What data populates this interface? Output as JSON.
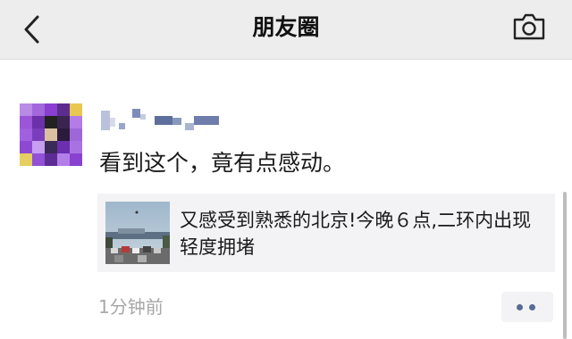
{
  "header": {
    "title": "朋友圈",
    "back_icon": "chevron-left-icon",
    "camera_icon": "camera-icon",
    "background": "#ededed"
  },
  "post": {
    "text": "看到这个，竟有点感动。",
    "link": {
      "title": "又感受到熟悉的北京!今晚６点,二环内出现轻度拥堵"
    },
    "timestamp": "1分钟前",
    "more_icon": "more-dots-icon"
  },
  "colors": {
    "accent": "#586b95",
    "timestamp": "#a7a7a7",
    "card_background": "#f3f3f5"
  }
}
